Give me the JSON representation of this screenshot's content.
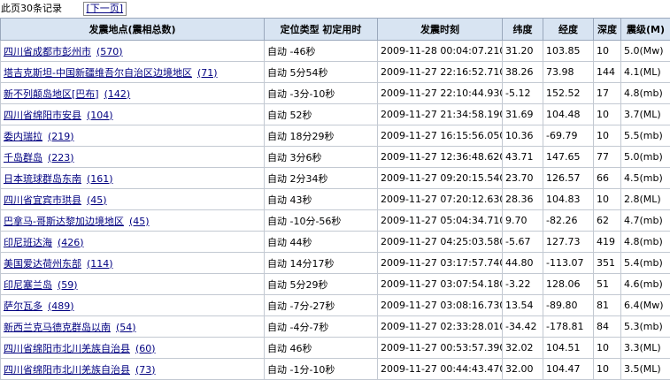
{
  "top": {
    "page_info": "此页30条记录",
    "next_page": "[下一页]"
  },
  "columns": [
    "发震地点(震相总数)",
    "定位类型  初定用时",
    "发震时刻",
    "纬度",
    "经度",
    "深度",
    "震级(M)"
  ],
  "rows": [
    {
      "location": "四川省成都市彭州市",
      "count": "(570)",
      "locate": "自动 -46秒",
      "time": "2009-11-28 00:04:07.210",
      "lat": "31.20",
      "lon": "103.85",
      "depth": "10",
      "mag": "5.0(Mw)"
    },
    {
      "location": "塔吉克斯坦-中国新疆维吾尔自治区边境地区",
      "count": "(71)",
      "locate": "自动 5分54秒",
      "time": "2009-11-27 22:16:52.710",
      "lat": "38.26",
      "lon": "73.98",
      "depth": "144",
      "mag": "4.1(ML)"
    },
    {
      "location": "新不列颠岛地区[巴布]",
      "count": "(142)",
      "locate": "自动 -3分-10秒",
      "time": "2009-11-27 22:10:44.930",
      "lat": "-5.12",
      "lon": "152.52",
      "depth": "17",
      "mag": "4.8(mb)"
    },
    {
      "location": "四川省绵阳市安县",
      "count": "(104)",
      "locate": "自动 52秒",
      "time": "2009-11-27 21:34:58.190",
      "lat": "31.69",
      "lon": "104.48",
      "depth": "10",
      "mag": "3.7(ML)"
    },
    {
      "location": "委内瑞拉",
      "count": "(219)",
      "locate": "自动 18分29秒",
      "time": "2009-11-27 16:15:56.050",
      "lat": "10.36",
      "lon": "-69.79",
      "depth": "10",
      "mag": "5.5(mb)"
    },
    {
      "location": "千岛群岛",
      "count": "(223)",
      "locate": "自动 3分6秒",
      "time": "2009-11-27 12:36:48.620",
      "lat": "43.71",
      "lon": "147.65",
      "depth": "77",
      "mag": "5.0(mb)"
    },
    {
      "location": "日本琉球群岛东南",
      "count": "(161)",
      "locate": "自动 2分34秒",
      "time": "2009-11-27 09:20:15.540",
      "lat": "23.70",
      "lon": "126.57",
      "depth": "66",
      "mag": "4.5(mb)"
    },
    {
      "location": "四川省宜宾市珙县",
      "count": "(45)",
      "locate": "自动 43秒",
      "time": "2009-11-27 07:20:12.630",
      "lat": "28.36",
      "lon": "104.83",
      "depth": "10",
      "mag": "2.8(ML)"
    },
    {
      "location": "巴拿马-哥斯达黎加边境地区",
      "count": "(45)",
      "locate": "自动 -10分-56秒",
      "time": "2009-11-27 05:04:34.710",
      "lat": "9.70",
      "lon": "-82.26",
      "depth": "62",
      "mag": "4.7(mb)"
    },
    {
      "location": "印尼班达海",
      "count": "(426)",
      "locate": "自动 44秒",
      "time": "2009-11-27 04:25:03.580",
      "lat": "-5.67",
      "lon": "127.73",
      "depth": "419",
      "mag": "4.8(mb)"
    },
    {
      "location": "美国爱达荷州东部",
      "count": "(114)",
      "locate": "自动 14分17秒",
      "time": "2009-11-27 03:17:57.740",
      "lat": "44.80",
      "lon": "-113.07",
      "depth": "351",
      "mag": "5.4(mb)"
    },
    {
      "location": "印尼塞兰岛",
      "count": "(59)",
      "locate": "自动 5分29秒",
      "time": "2009-11-27 03:07:54.180",
      "lat": "-3.22",
      "lon": "128.06",
      "depth": "51",
      "mag": "4.6(mb)"
    },
    {
      "location": "萨尔瓦多",
      "count": "(489)",
      "locate": "自动 -7分-27秒",
      "time": "2009-11-27 03:08:16.730",
      "lat": "13.54",
      "lon": "-89.80",
      "depth": "81",
      "mag": "6.4(Mw)"
    },
    {
      "location": "新西兰克马德克群岛以南",
      "count": "(54)",
      "locate": "自动 -4分-7秒",
      "time": "2009-11-27 02:33:28.010",
      "lat": "-34.42",
      "lon": "-178.81",
      "depth": "84",
      "mag": "5.3(mb)"
    },
    {
      "location": "四川省绵阳市北川羌族自治县",
      "count": "(60)",
      "locate": "自动 46秒",
      "time": "2009-11-27 00:53:57.390",
      "lat": "32.02",
      "lon": "104.51",
      "depth": "10",
      "mag": "3.3(ML)"
    },
    {
      "location": "四川省绵阳市北川羌族自治县",
      "count": "(73)",
      "locate": "自动 -1分-10秒",
      "time": "2009-11-27 00:44:43.470",
      "lat": "32.00",
      "lon": "104.47",
      "depth": "10",
      "mag": "3.5(ML)"
    }
  ]
}
